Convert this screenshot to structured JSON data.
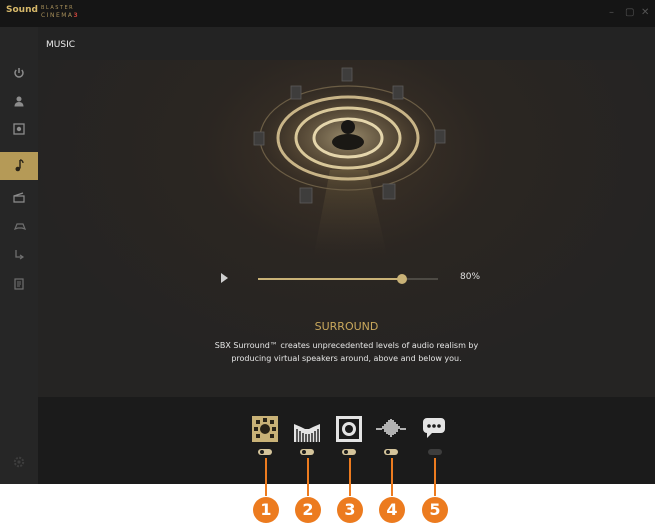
{
  "app": {
    "logo_sound": "Sound",
    "logo_blaster": "BLASTER",
    "logo_cinema": "CINEMA",
    "logo_version": "3",
    "window_controls": {
      "minimize": "–",
      "maximize": "▢",
      "close": "✕"
    }
  },
  "header": {
    "title": "MUSIC"
  },
  "sidebar": {
    "items": [
      {
        "icon": "power-icon",
        "active": false
      },
      {
        "icon": "user-icon",
        "active": false
      },
      {
        "icon": "speaker-icon",
        "active": false
      },
      {
        "icon": "music-note-icon",
        "active": true
      },
      {
        "icon": "movie-clapper-icon",
        "active": false
      },
      {
        "icon": "game-controller-icon",
        "active": false
      },
      {
        "icon": "voice-icon",
        "active": false
      },
      {
        "icon": "document-icon",
        "active": false
      }
    ],
    "bottom_icon": "settings-icon"
  },
  "player": {
    "volume_label": "80%",
    "volume_value": 0.8
  },
  "feature": {
    "title": "SURROUND",
    "description_line1": "SBX Surround™ creates unprecedented levels of audio realism by",
    "description_line2": "producing virtual speakers around, above and below you."
  },
  "features": [
    {
      "icon": "surround-icon",
      "enabled": true,
      "selected": true
    },
    {
      "icon": "crystalizer-icon",
      "enabled": true,
      "selected": false
    },
    {
      "icon": "bass-icon",
      "enabled": true,
      "selected": false
    },
    {
      "icon": "smart-volume-icon",
      "enabled": true,
      "selected": false
    },
    {
      "icon": "dialog-plus-icon",
      "enabled": false,
      "selected": false
    }
  ],
  "callouts": [
    "1",
    "2",
    "3",
    "4",
    "5"
  ],
  "colors": {
    "accent": "#b59a57",
    "callout": "#ec7b1f",
    "background": "#1d1d1d"
  }
}
